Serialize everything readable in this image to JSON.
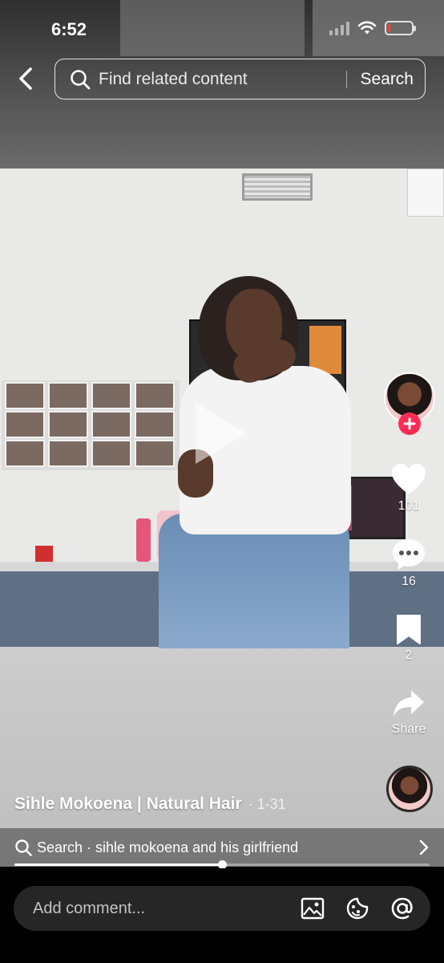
{
  "status_bar": {
    "time": "6:52",
    "battery_level": 0.12
  },
  "top_bar": {
    "back_icon": "chevron-left-icon",
    "search_placeholder": "Find related content",
    "search_button": "Search"
  },
  "right_rail": {
    "follow_icon": "plus-icon",
    "like_count": "101",
    "comment_count": "16",
    "bookmark_count": "2",
    "share_label": "Share"
  },
  "caption": {
    "author": "Sihle Mokoena | Natural Hair",
    "date": "· 1-31"
  },
  "related_search": {
    "text": "Search · sihle mokoena and his girlfriend"
  },
  "playback": {
    "progress": 0.5
  },
  "comment_bar": {
    "placeholder": "Add comment..."
  },
  "colors": {
    "accent": "#fe2c55",
    "battery_low": "#ff3b30"
  }
}
